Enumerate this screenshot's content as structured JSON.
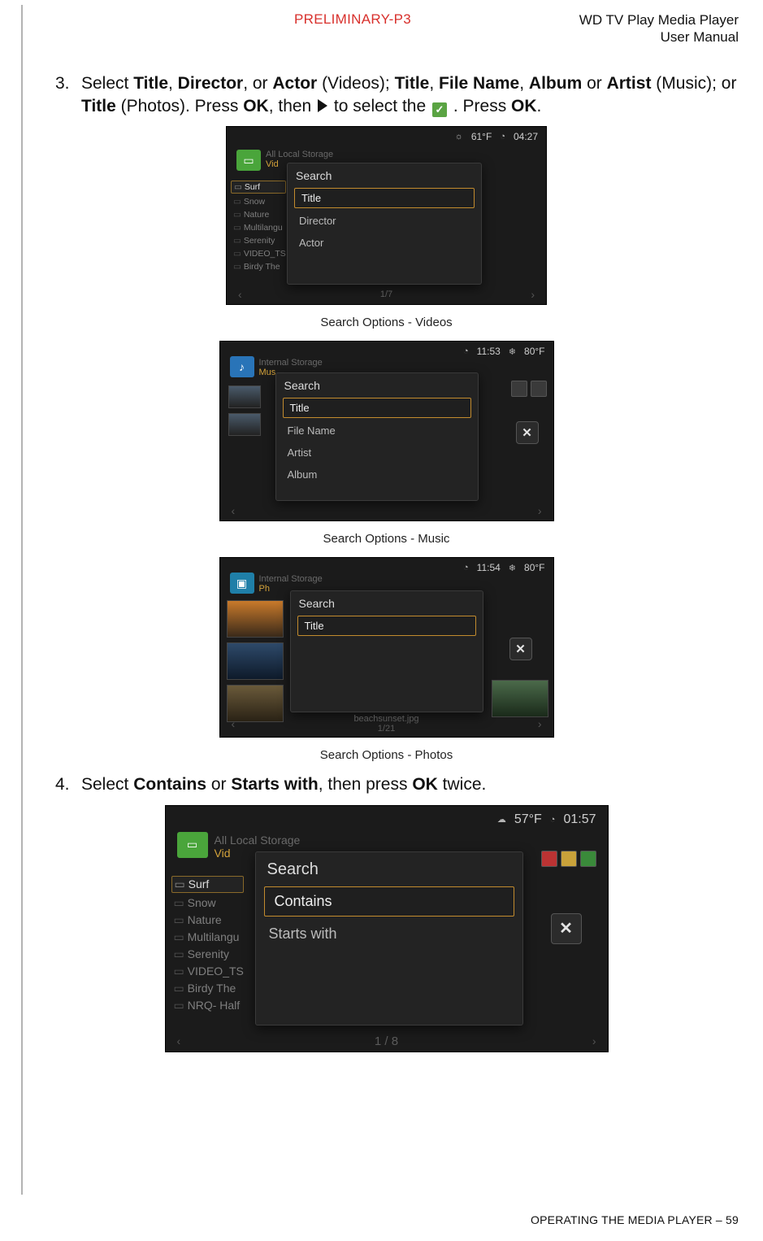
{
  "header": {
    "preliminary": "PRELIMINARY-P3",
    "product": "WD TV Play Media Player",
    "doc": "User Manual"
  },
  "step3": {
    "num": "3.",
    "pre": "Select ",
    "b1": "Title",
    "c1": ", ",
    "b2": "Director",
    "c2": ", or ",
    "b3": "Actor",
    "c3": " (Videos); ",
    "b4": "Title",
    "c4": ", ",
    "b5": "File Name",
    "c5": ", ",
    "b6": "Album",
    "c6": " or ",
    "b7": "Artist",
    "c7": " (Music); or ",
    "b8": "Title",
    "c8": " (Photos). Press ",
    "b9": "OK",
    "c9": ", then ",
    "c10": " to select the ",
    "c11": ". Press ",
    "b10": "OK",
    "c12": "."
  },
  "shot1": {
    "status_temp": "61°F",
    "status_time": "04:27",
    "crumb1": "All Local Storage",
    "crumb2": "Vid",
    "folders": [
      "Surf",
      "Snow",
      "Nature",
      "Multilangu",
      "Serenity",
      "VIDEO_TS",
      "Birdy The"
    ],
    "panel_title": "Search",
    "opts": [
      "Title",
      "Director",
      "Actor"
    ],
    "pager": "1/7",
    "caption": "Search Options - Videos"
  },
  "shot2": {
    "status_time": "11:53",
    "status_temp": "80°F",
    "crumb1": "Internal Storage",
    "crumb2": "Mus",
    "panel_title": "Search",
    "opts": [
      "Title",
      "File Name",
      "Artist",
      "Album"
    ],
    "caption": "Search Options - Music"
  },
  "shot3": {
    "status_time": "11:54",
    "status_temp": "80°F",
    "crumb1": "Internal Storage",
    "crumb2": "Ph",
    "panel_title": "Search",
    "opts": [
      "Title"
    ],
    "bottom_label": "beachsunset.jpg",
    "bottom_count": "1/21",
    "caption": "Search Options - Photos"
  },
  "step4": {
    "num": "4.",
    "pre": "Select ",
    "b1": "Contains",
    "c1": " or ",
    "b2": "Starts with",
    "c2": ", then press ",
    "b3": "OK",
    "c3": " twice."
  },
  "shot4": {
    "status_temp": "57°F",
    "status_time": "01:57",
    "crumb1": "All Local Storage",
    "crumb2": "Vid",
    "folders": [
      "Surf",
      "Snow",
      "Nature",
      "Multilangu",
      "Serenity",
      "VIDEO_TS",
      "Birdy The",
      "NRQ- Half"
    ],
    "panel_title": "Search",
    "opts": [
      "Contains",
      "Starts with"
    ],
    "pager": "1 / 8"
  },
  "footer": {
    "section": "OPERATING THE MEDIA PLAYER",
    "sep": " – ",
    "page": "59"
  }
}
